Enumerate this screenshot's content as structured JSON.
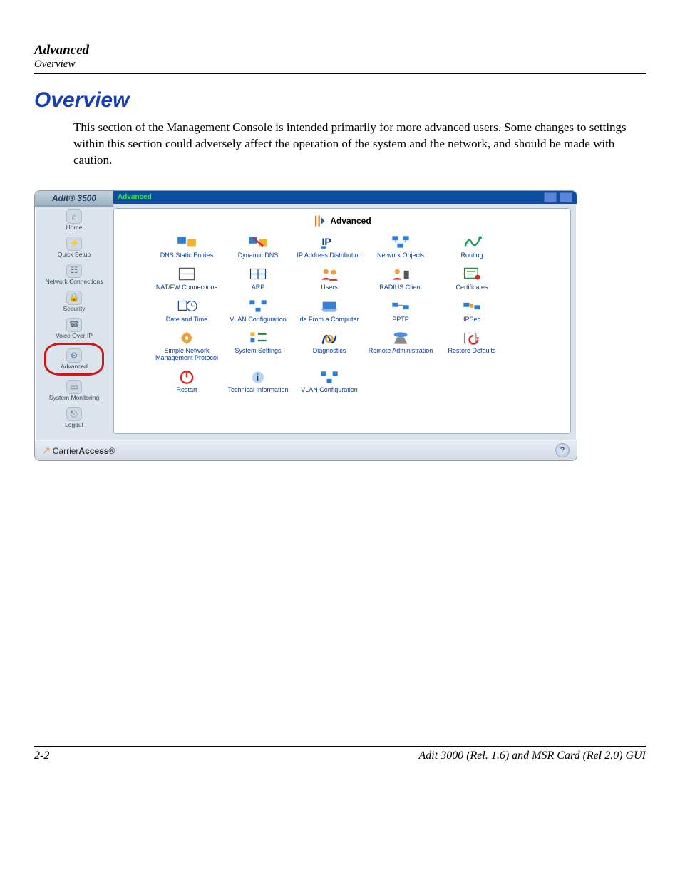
{
  "header": {
    "title": "Advanced",
    "subtitle": "Overview"
  },
  "section_title": "Overview",
  "body_text": "This section of the Management Console is intended primarily for more advanced users. Some changes to settings within this section could adversely affect the operation of the system and the network, and should be made with caution.",
  "app": {
    "device": "Adit® 3500",
    "breadcrumb": "Advanced",
    "panel_title": "Advanced",
    "nav": [
      {
        "label": "Home"
      },
      {
        "label": "Quick Setup"
      },
      {
        "label": "Network Connections"
      },
      {
        "label": "Security"
      },
      {
        "label": "Voice Over IP"
      },
      {
        "label": "Advanced"
      },
      {
        "label": "System Monitoring"
      },
      {
        "label": "Logout"
      }
    ],
    "grid": [
      [
        {
          "label": "DNS Static Entries"
        },
        {
          "label": "Dynamic DNS"
        },
        {
          "label": "IP Address Distribution"
        },
        {
          "label": "Network Objects"
        },
        {
          "label": "Routing"
        }
      ],
      [
        {
          "label": "NAT/FW Connections"
        },
        {
          "label": "ARP"
        },
        {
          "label": "Users"
        },
        {
          "label": "RADIUS Client"
        },
        {
          "label": "Certificates"
        }
      ],
      [
        {
          "label": "Date and Time"
        },
        {
          "label": "VLAN Configuration"
        },
        {
          "label": "de From a Computer"
        },
        {
          "label": "PPTP"
        },
        {
          "label": "IPSec"
        }
      ],
      [
        {
          "label": "Simple Network Management Protocol"
        },
        {
          "label": "System Settings"
        },
        {
          "label": "Diagnostics"
        },
        {
          "label": "Remote Administration"
        },
        {
          "label": "Restore Defaults"
        }
      ],
      [
        {
          "label": "Restart"
        },
        {
          "label": "Technical Information"
        },
        {
          "label": "VLAN Configuration"
        }
      ]
    ],
    "footer_brand_a": "Carrier",
    "footer_brand_b": "Access",
    "help": "?"
  },
  "footer": {
    "page": "2-2",
    "doc": "Adit 3000 (Rel. 1.6) and MSR Card (Rel 2.0) GUI"
  }
}
